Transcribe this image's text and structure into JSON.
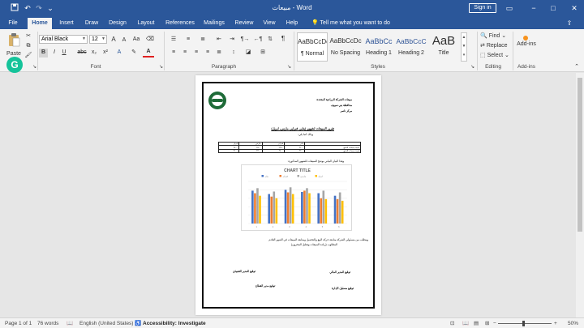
{
  "window": {
    "title": "مبيعات  -  Word",
    "sign_in": "Sign in"
  },
  "quick_access": {
    "save_icon": "save-icon",
    "undo_icon": "undo-icon",
    "redo_icon": "redo-icon",
    "more_icon": "chevron-down-icon"
  },
  "tabs": [
    "File",
    "Home",
    "Insert",
    "Draw",
    "Design",
    "Layout",
    "References",
    "Mailings",
    "Review",
    "View",
    "Help"
  ],
  "active_tab": "Home",
  "tell_me": "Tell me what you want to do",
  "ribbon": {
    "clipboard": {
      "paste": "Paste",
      "label": "Clipboard"
    },
    "font": {
      "name": "Arial Black",
      "size": "12",
      "label": "Font",
      "grow": "A",
      "shrink": "A",
      "case": "Aa",
      "bold": "B",
      "italic": "I",
      "underline": "U",
      "strike": "abc",
      "sub": "x₂",
      "sup": "x²",
      "color": "A"
    },
    "paragraph": {
      "label": "Paragraph"
    },
    "styles": {
      "label": "Styles",
      "items": [
        {
          "sample": "AaBbCcDc",
          "name": "¶ Normal"
        },
        {
          "sample": "AaBbCcDc",
          "name": "No Spacing"
        },
        {
          "sample": "AaBbCc",
          "name": "Heading 1"
        },
        {
          "sample": "AaBbCcC",
          "name": "Heading 2"
        },
        {
          "sample": "AaB",
          "name": "Title"
        }
      ]
    },
    "editing": {
      "find": "Find",
      "replace": "Replace",
      "select": "Select",
      "label": "Editing"
    },
    "addins": {
      "label": "Add-ins",
      "button": "Add-ins"
    }
  },
  "document": {
    "header_lines": [
      "مبيعات الشركة الزراعية المتحدة",
      "محافظة بني سويف",
      "مركز ناصر"
    ],
    "report_title": "تقرير المبيعات لشهور (يناير، فبراير، مارس، ابريل)",
    "intro": "وذلك كما يلي:",
    "table": {
      "rows": [
        [
          "",
          "يناير",
          "فبراير",
          "مارس",
          "ابريل"
        ],
        [
          "كمية مبيعات الشهر",
          "٢٢٠٠",
          "٢٣٤٠",
          "٢٥٠٠",
          "٢٧٠٠"
        ],
        [
          "قيمة مبيعات الشهر",
          "٣٢٠٠",
          "٣٥٠٠",
          "٣٣٠٠",
          "٣١٠٠"
        ]
      ]
    },
    "chart_caption": "وهذا البيان البياني يوضح المبيعات للشهور المذكورة:",
    "closing_1": "ويتطلب من مسئولي الشركة متابعة حركة البيع والتحصيل ومتابعة المبيعات في الشهر القادم",
    "closing_2": "المطلوب (زيادة المبيعات وتقليل المخزون)",
    "signatures": [
      "توقيع المدير المالي",
      "توقيع المدير التنفيذي",
      "توقيع مسئول الإدارة",
      "توقيع مدير القطاع"
    ]
  },
  "chart_data": {
    "type": "bar",
    "title": "CHART TITLE",
    "categories": [
      "1",
      "2",
      "3",
      "4",
      "5",
      "6"
    ],
    "series": [
      {
        "name": "يناير",
        "color": "#4472c4",
        "values": [
          78,
          70,
          80,
          75,
          72,
          66
        ]
      },
      {
        "name": "فبراير",
        "color": "#ed7d31",
        "values": [
          72,
          64,
          74,
          78,
          60,
          58
        ]
      },
      {
        "name": "مارس",
        "color": "#a5a5a5",
        "values": [
          84,
          76,
          86,
          84,
          78,
          74
        ]
      },
      {
        "name": "ابريل",
        "color": "#ffc000",
        "values": [
          66,
          60,
          70,
          72,
          58,
          54
        ]
      }
    ],
    "ylim": [
      0,
      100
    ],
    "grid": true,
    "legend_position": "top"
  },
  "status": {
    "page": "Page 1 of 1",
    "words": "76 words",
    "language": "English (United States)",
    "accessibility": "Accessibility: Investigate",
    "zoom": "50%"
  },
  "colors": {
    "brand": "#2b579a",
    "ribbon_bg": "#f3f3f3",
    "grammarly": "#15c39a"
  }
}
